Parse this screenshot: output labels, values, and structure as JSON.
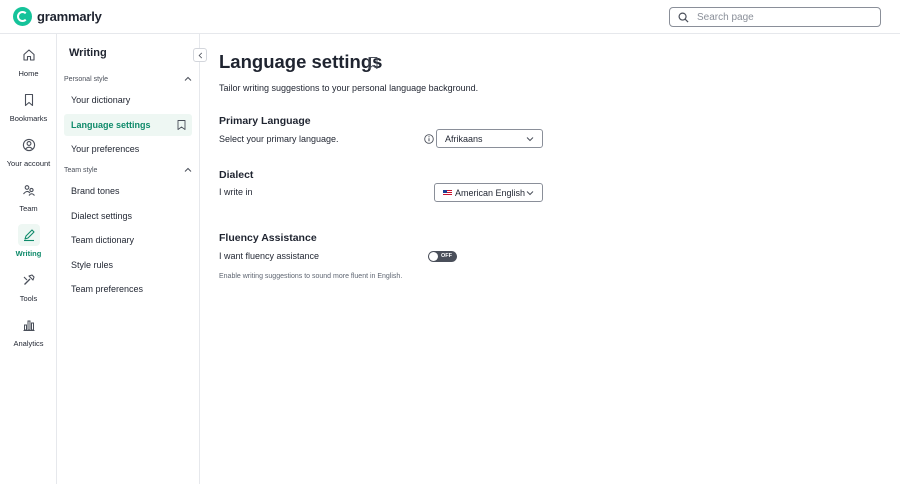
{
  "app": {
    "name": "grammarly"
  },
  "search": {
    "placeholder": "Search page",
    "value": ""
  },
  "rail": [
    {
      "label": "Home",
      "icon": "home-icon"
    },
    {
      "label": "Bookmarks",
      "icon": "bookmark-icon"
    },
    {
      "label": "Your account",
      "icon": "account-icon"
    },
    {
      "label": "Team",
      "icon": "team-icon"
    },
    {
      "label": "Writing",
      "icon": "pen-icon",
      "active": true
    },
    {
      "label": "Tools",
      "icon": "tools-icon"
    },
    {
      "label": "Analytics",
      "icon": "analytics-icon"
    }
  ],
  "sidebar": {
    "title": "Writing",
    "personal_section": "Personal style",
    "personal_items": [
      "Your dictionary",
      "Language settings",
      "Your preferences"
    ],
    "team_section": "Team style",
    "team_items": [
      "Brand tones",
      "Dialect settings",
      "Team dictionary",
      "Style rules",
      "Team preferences"
    ],
    "active_item": "Language settings"
  },
  "main": {
    "title": "Language settings",
    "subtitle": "Tailor writing suggestions to your personal language background.",
    "primary": {
      "heading": "Primary Language",
      "text": "Select your primary language.",
      "value": "Afrikaans"
    },
    "dialect": {
      "heading": "Dialect",
      "text": "I write in",
      "value": "American English"
    },
    "fluency": {
      "heading": "Fluency Assistance",
      "text": "I want fluency assistance",
      "toggle": "OFF",
      "hint": "Enable writing suggestions to sound more fluent in English."
    }
  },
  "colors": {
    "brand": "#15c39a",
    "active_text": "#0e8a6a",
    "active_bg": "#eef7f3"
  }
}
